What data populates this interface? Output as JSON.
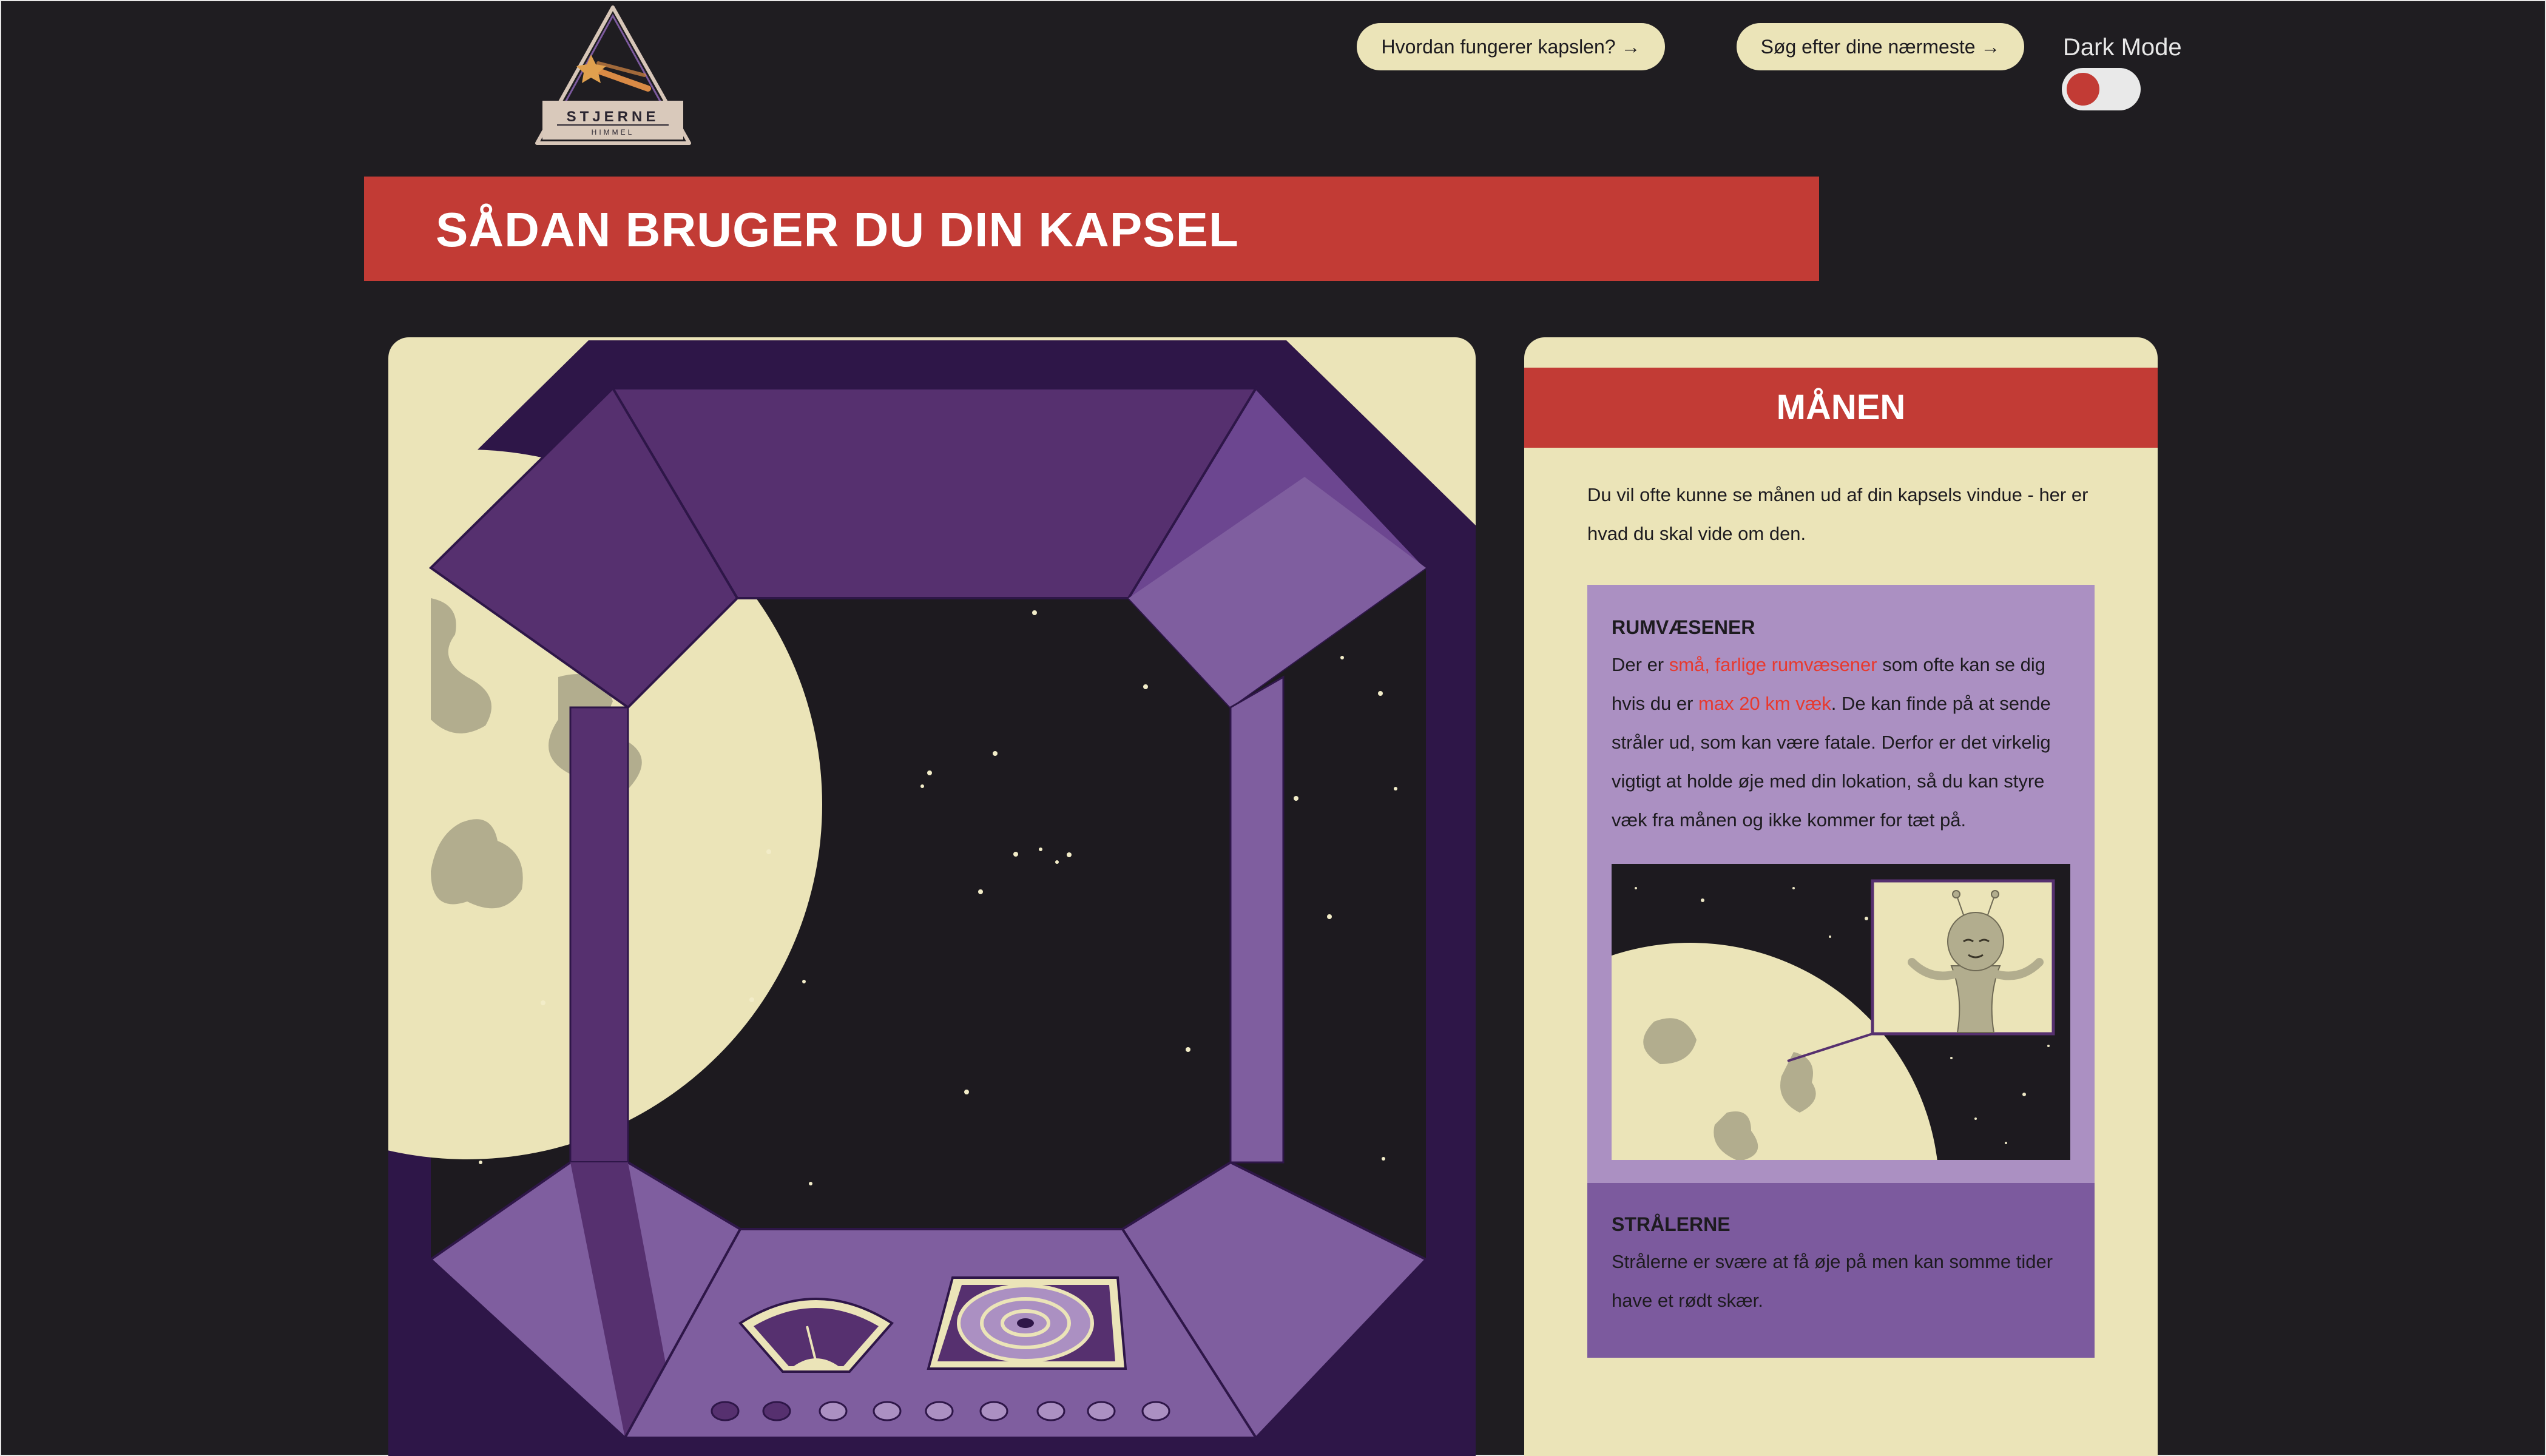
{
  "logo": {
    "name": "STJERNE",
    "sub": "HIMMEL",
    "icon": "shooting-star-icon"
  },
  "nav": {
    "how_button": "Hvordan fungerer kapslen? →",
    "search_button": "Søg efter dine nærmeste →",
    "dark_mode_label": "Dark Mode"
  },
  "page": {
    "title": "SÅDAN BRUGER DU DIN KAPSEL"
  },
  "info": {
    "heading": "MÅNEN",
    "intro": "Du vil ofte kunne se månen ud af din kapsels vindue - her er hvad du skal vide om den.",
    "aliens": {
      "heading": "RUMVÆSENER",
      "text_1": "Der er ",
      "highlight_1": "små, farlige rumvæsener",
      "text_2": " som ofte kan se dig hvis du er ",
      "highlight_2": "max 20 km væk",
      "text_3": ". De kan finde på at sende stråler ud, som kan være fatale. Derfor er det virkelig vigtigt at holde øje med din lokation, så du kan styre væk fra månen og ikke kommer for tæt på."
    },
    "rays": {
      "heading": "STRÅLERNE",
      "text": "Strålerne er svære at få øje på men kan somme tider have et rødt skær."
    }
  },
  "colors": {
    "background": "#1f1d21",
    "accent_red": "#c23b35",
    "cream": "#ebe4b8",
    "purple_light": "#ab90c2",
    "purple_mid": "#7c5a9e",
    "purple_dark": "#2e1648",
    "highlight": "#e8392e"
  }
}
